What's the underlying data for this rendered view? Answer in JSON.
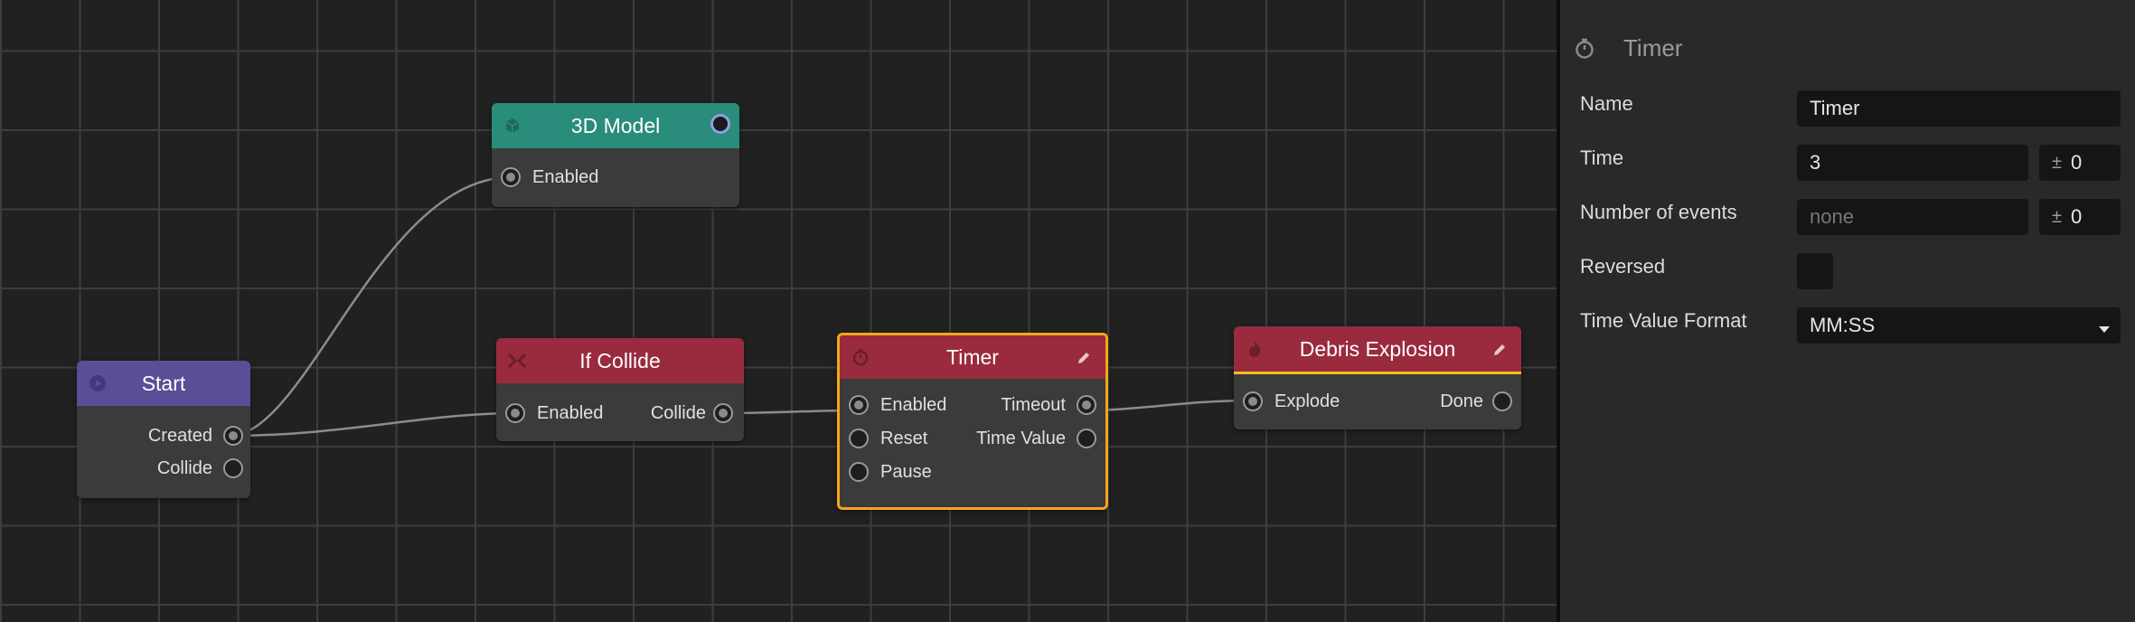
{
  "canvas": {
    "nodes": {
      "model": {
        "title": "3D Model",
        "color": "#2a8c7a",
        "icon": "cube-icon",
        "ports_in": [
          "Enabled"
        ]
      },
      "start": {
        "title": "Start",
        "color": "#5a4f96",
        "icon": "play-icon",
        "ports_out": [
          "Created",
          "Collide"
        ]
      },
      "collide": {
        "title": "If Collide",
        "color": "#9a2a3e",
        "icon": "collide-icon",
        "ports_in": [
          "Enabled"
        ],
        "ports_out": [
          "Collide"
        ]
      },
      "timer": {
        "title": "Timer",
        "color": "#9a2a3e",
        "icon": "stopwatch-icon",
        "ports_in": [
          "Enabled",
          "Reset",
          "Pause"
        ],
        "ports_out": [
          "Timeout",
          "Time Value"
        ],
        "selected": true
      },
      "debris": {
        "title": "Debris Explosion",
        "color": "#9a2a3e",
        "icon": "fire-icon",
        "ports_in": [
          "Explode"
        ],
        "ports_out": [
          "Done"
        ]
      }
    },
    "selection_color": "#f0a818"
  },
  "panel": {
    "title": "Timer",
    "title_icon": "stopwatch-icon",
    "name_label": "Name",
    "name_value": "Timer",
    "time_label": "Time",
    "time_value": "3",
    "time_variance": "0",
    "events_label": "Number of events",
    "events_placeholder": "none",
    "events_variance": "0",
    "plusminus": "±",
    "reversed_label": "Reversed",
    "format_label": "Time Value Format",
    "format_value": "MM:SS"
  }
}
